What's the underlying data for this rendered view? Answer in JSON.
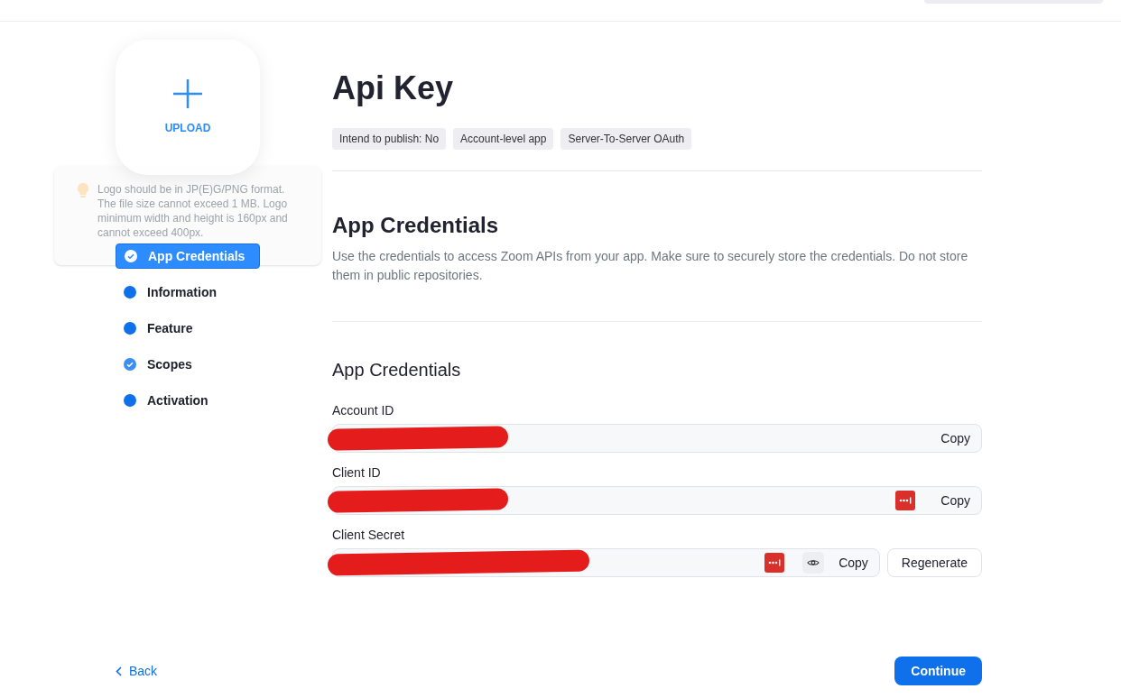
{
  "upload": {
    "label": "UPLOAD",
    "tip": "Logo should be in JP(E)G/PNG format. The file size cannot exceed 1 MB. Logo minimum width and height is 160px and cannot exceed 400px."
  },
  "steps": [
    {
      "label": "App Credentials",
      "kind": "check",
      "selected": true
    },
    {
      "label": "Information",
      "kind": "dot",
      "selected": false
    },
    {
      "label": "Feature",
      "kind": "dot",
      "selected": false
    },
    {
      "label": "Scopes",
      "kind": "check",
      "selected": false
    },
    {
      "label": "Activation",
      "kind": "dot",
      "selected": false
    }
  ],
  "title": "Api Key",
  "tags": [
    "Intend to publish: No",
    "Account-level app",
    "Server-To-Server OAuth"
  ],
  "section": {
    "title": "App Credentials",
    "description": "Use the credentials to access Zoom APIs from your app. Make sure to securely store the credentials. Do not store them in public repositories."
  },
  "credentials": {
    "title": "App Credentials",
    "fields": [
      {
        "label": "Account ID",
        "copy": "Copy",
        "password_manager": false,
        "reveal": false
      },
      {
        "label": "Client ID",
        "copy": "Copy",
        "password_manager": true,
        "reveal": false
      },
      {
        "label": "Client Secret",
        "copy": "Copy",
        "password_manager": true,
        "reveal": true,
        "regenerate": "Regenerate"
      }
    ]
  },
  "footer": {
    "back": "Back",
    "continue": "Continue"
  }
}
